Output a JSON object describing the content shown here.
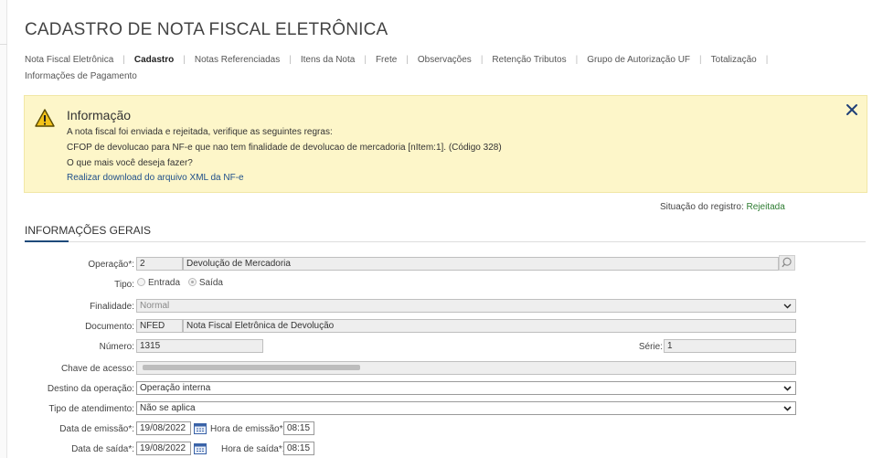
{
  "page": {
    "title": "CADASTRO DE NOTA FISCAL ELETRÔNICA"
  },
  "tabs": [
    {
      "label": "Nota Fiscal Eletrônica"
    },
    {
      "label": "Cadastro"
    },
    {
      "label": "Notas Referenciadas"
    },
    {
      "label": "Itens da Nota"
    },
    {
      "label": "Frete"
    },
    {
      "label": "Observações"
    },
    {
      "label": "Retenção Tributos"
    },
    {
      "label": "Grupo de Autorização UF"
    },
    {
      "label": "Totalização"
    },
    {
      "label": "Informações de Pagamento"
    }
  ],
  "info": {
    "title": "Informação",
    "line1": "A nota fiscal foi enviada e rejeitada, verifique as seguintes regras:",
    "line2": "CFOP de devolucao para NF-e que nao tem finalidade de devolucao de mercadoria [nItem:1]. (Código 328)",
    "line3": "O que mais você deseja fazer?",
    "download_link": "Realizar download do arquivo XML da NF-e"
  },
  "status": {
    "label": "Situação do registro:",
    "value": "Rejeitada"
  },
  "section": {
    "title": "INFORMAÇÕES GERAIS"
  },
  "form": {
    "operacao_label": "Operação*:",
    "operacao_code": "2",
    "operacao_desc": "Devolução de Mercadoria",
    "tipo_label": "Tipo:",
    "tipo_entrada": "Entrada",
    "tipo_saida": "Saída",
    "finalidade_label": "Finalidade:",
    "finalidade_value": "Normal",
    "documento_label": "Documento:",
    "documento_code": "NFED",
    "documento_desc": "Nota Fiscal Eletrônica de Devolução",
    "numero_label": "Número:",
    "numero_value": "1315",
    "serie_label": "Série:",
    "serie_value": "1",
    "chave_label": "Chave de acesso:",
    "destino_label": "Destino da operação:",
    "destino_value": "Operação interna",
    "atendimento_label": "Tipo de atendimento:",
    "atendimento_value": "Não se aplica",
    "emissao_label": "Data de emissão*:",
    "emissao_value": "19/08/2022",
    "hora_emissao_label": "Hora de emissão*:",
    "hora_emissao_value": "08:15",
    "saida_label": "Data de saída*:",
    "saida_value": "19/08/2022",
    "hora_saida_label": "Hora de saída*:",
    "hora_saida_value": "08:15"
  },
  "colors": {
    "accent": "#1e4a7a",
    "info_bg": "#fdf6c9",
    "status_ok": "#2e7d32",
    "close": "#1f3f77"
  },
  "icons": [
    "warning-icon",
    "close-icon",
    "search-icon",
    "chevron-down-icon",
    "calendar-icon"
  ]
}
